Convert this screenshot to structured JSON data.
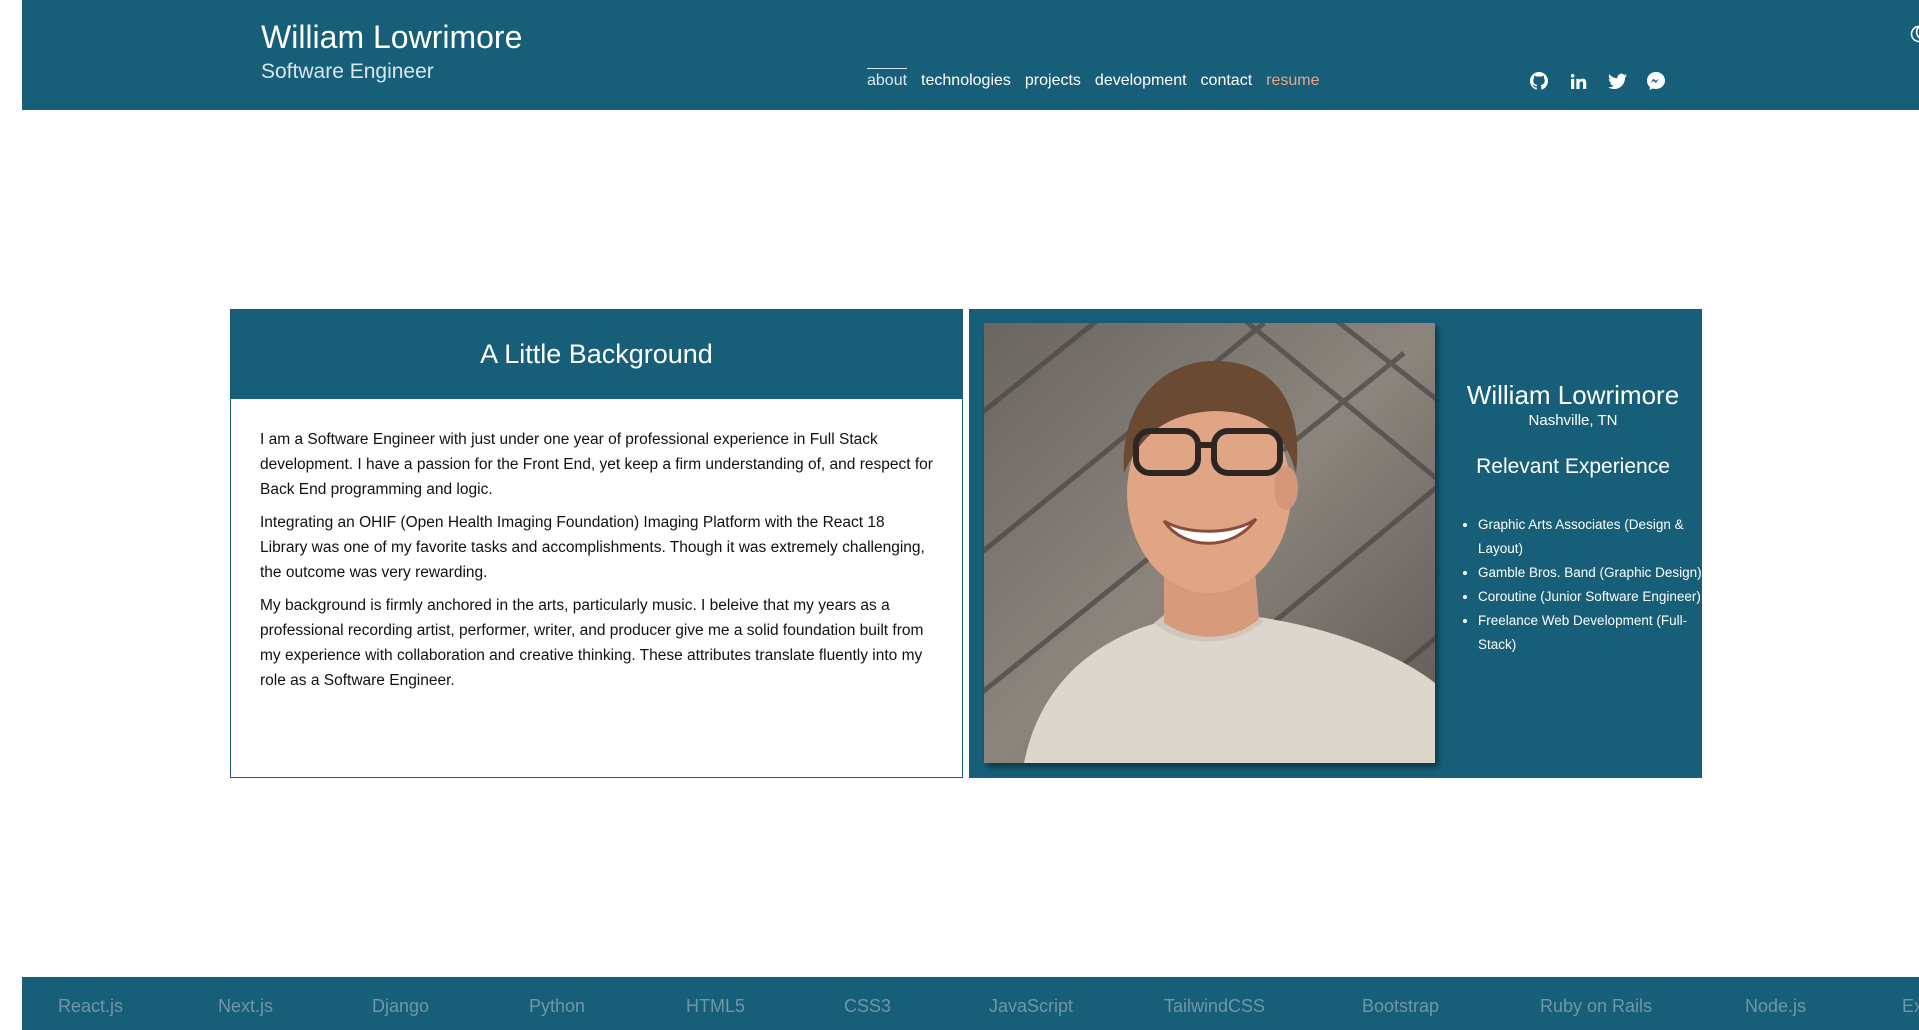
{
  "header": {
    "name": "William Lowrimore",
    "role": "Software Engineer",
    "nav": [
      "about",
      "technologies",
      "projects",
      "development",
      "contact",
      "resume"
    ],
    "active_nav": "about",
    "social_icons": [
      "github-icon",
      "linkedin-icon",
      "twitter-icon",
      "messenger-icon"
    ],
    "theme_toggle_icon": "moon-icon"
  },
  "background_card": {
    "title": "A Little Background",
    "paragraphs": [
      "I am a Software Engineer with just under one year of professional experience in Full Stack development. I have a passion for the Front End, yet keep a firm understanding of, and respect for Back End programming and logic.",
      "Integrating an OHIF (Open Health Imaging Foundation) Imaging Platform with the React 18 Library was one of my favorite tasks and accomplishments. Though it was extremely challenging, the outcome was very rewarding.",
      "My background is firmly anchored in the arts, particularly music. I beleive that my years as a professional recording artist, performer, writer, and producer give me a solid foundation built from my experience with collaboration and creative thinking. These attributes translate fluently into my role as a Software Engineer."
    ]
  },
  "profile_card": {
    "name": "William Lowrimore",
    "location": "Nashville, TN",
    "experience_title": "Relevant Experience",
    "experience": [
      "Graphic Arts Associates (Design & Layout)",
      "Gamble Bros. Band (Graphic Design)",
      "Coroutine (Junior Software Engineer)",
      "Freelance Web Development (Full-Stack)"
    ]
  },
  "ticker": {
    "technologies": [
      "React.js",
      "Next.js",
      "Django",
      "Python",
      "HTML5",
      "CSS3",
      "JavaScript",
      "TailwindCSS",
      "Bootstrap",
      "Ruby on Rails",
      "Node.js",
      "Ex"
    ]
  },
  "colors": {
    "primary": "#175f79",
    "resume_link": "#e9a58c",
    "ticker_text": "#6f97a8"
  }
}
